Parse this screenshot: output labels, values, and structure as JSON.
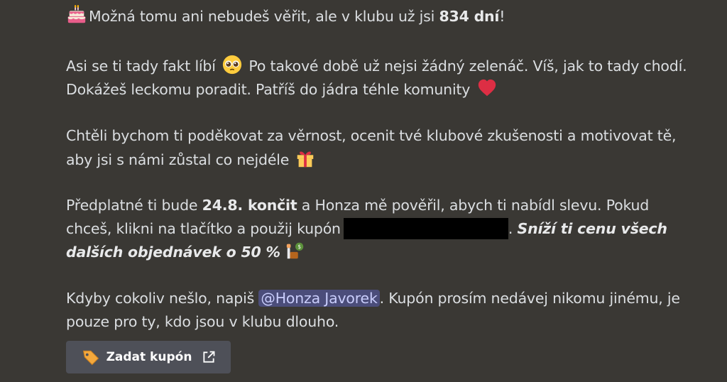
{
  "message": {
    "p1": {
      "emoji": "birthday-cake-icon",
      "text_before": "Možná tomu ani nebudeš věřit, ale v klubu už jsi ",
      "bold": "834 dní",
      "text_after": "!"
    },
    "p2": {
      "line1_a": "Asi se ti tady fakt líbí",
      "emoji1": "pleading-face-icon",
      "line1_b": "Po takové době už nejsi žádný zelenáč. Víš, jak to tady chodí.",
      "line2": "Dokážeš leckomu poradit. Patříš do jádra téhle komunity",
      "emoji2": "red-heart-icon"
    },
    "p3": {
      "line1": "Chtěli bychom ti poděkovat za věrnost, ocenit tvé klubové zkušenosti a motivovat tě,",
      "line2": "aby jsi s námi zůstal co nejdéle",
      "emoji": "gift-icon"
    },
    "p4": {
      "line1_a": "Předplatné ti bude ",
      "line1_bold": "24.8. končit",
      "line1_b": " a Honza mě pověřil, abych ti nabídl slevu. Pokud",
      "line2_a": "chceš, klikni na tlačítko a použij kupón",
      "line2_b": ". ",
      "line2_bi": "Sníží ti cenu všech",
      "line3_bi": "dalších objednávek o 50 %",
      "emoji": "money-bag-icon"
    },
    "p5": {
      "line1_a": "Kdyby cokoliv nešlo, napiš ",
      "mention": "@Honza Javorek",
      "line1_b": ". Kupón prosím nedávej nikomu jinému, je",
      "line2": "pouze pro ty, kdo jsou v klubu dlouho."
    }
  },
  "button": {
    "icon": "label-tag-icon",
    "label": "Zadat kupón",
    "ext_icon": "external-link-icon"
  }
}
